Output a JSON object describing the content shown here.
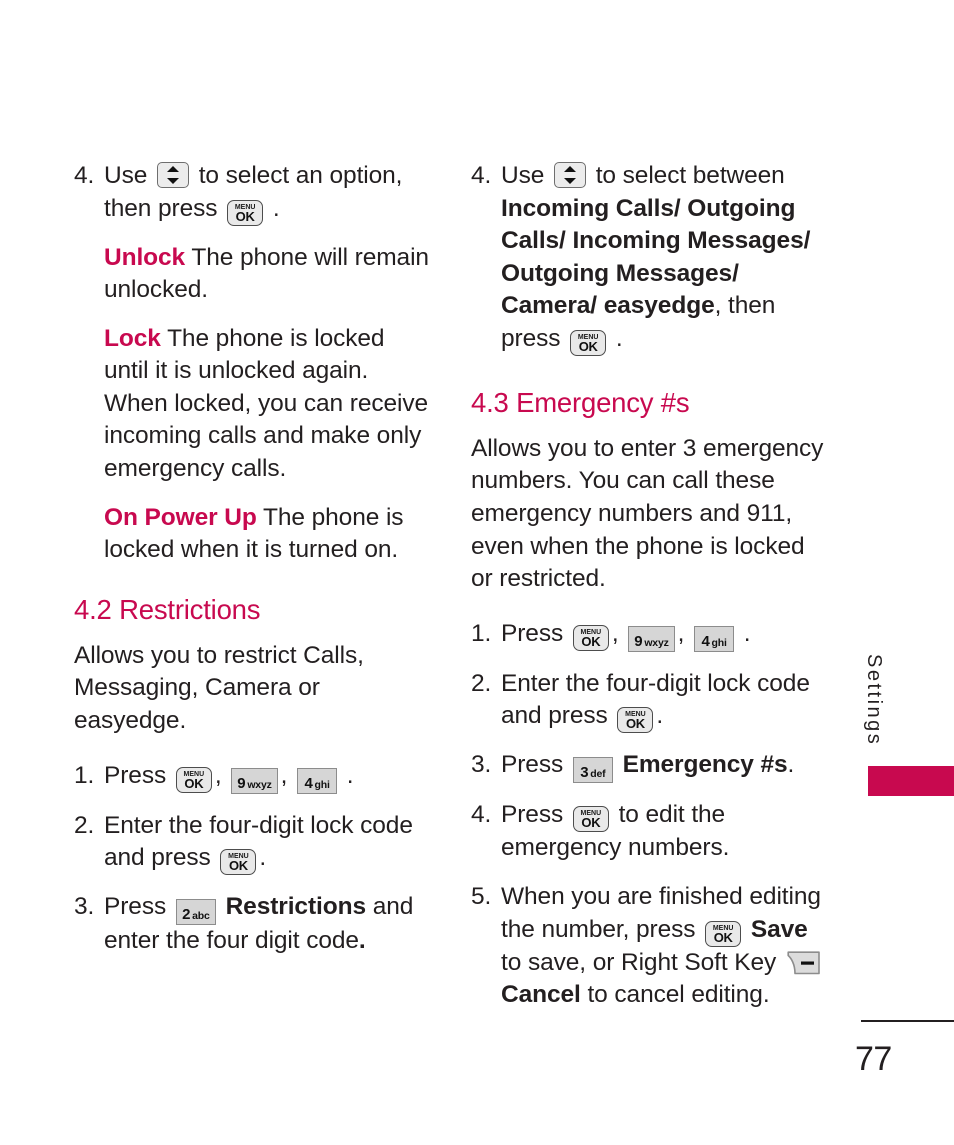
{
  "page": {
    "number": "77",
    "side_tab_label": "Settings",
    "accent_color": "#c8094f",
    "text_color": "#231f20"
  },
  "icons": {
    "nav_key": "updown-nav-key-icon",
    "menu_ok_key": "menu-ok-key-icon",
    "right_soft_key": "right-soft-key-icon",
    "menu_label_top": "MENU",
    "menu_label_bottom": "OK"
  },
  "keys": {
    "k9": {
      "digit": "9",
      "letters": "wxyz"
    },
    "k4": {
      "digit": "4",
      "letters": "ghi"
    },
    "k2": {
      "digit": "2",
      "letters": "abc"
    },
    "k3": {
      "digit": "3",
      "letters": "def"
    }
  },
  "left_column": {
    "step4": {
      "num": "4.",
      "text_a": "Use",
      "text_b": "to select an option,",
      "text_c": "then press",
      "text_d": "."
    },
    "definitions": [
      {
        "term": "Unlock",
        "body": "The phone will remain unlocked."
      },
      {
        "term": "Lock",
        "body": "The phone is locked until it is unlocked again. When locked, you can receive incoming calls and make only emergency calls."
      },
      {
        "term": "On Power Up",
        "body": "The phone is locked when it is turned on."
      }
    ],
    "section": {
      "heading": "4.2 Restrictions",
      "intro": "Allows you to restrict Calls, Messaging, Camera or easyedge.",
      "steps": [
        {
          "num": "1.",
          "pre": "Press",
          "sep1": ",",
          "sep2": ",",
          "post": "."
        },
        {
          "num": "2.",
          "text_a": "Enter the four-digit lock code and press",
          "text_b": "."
        },
        {
          "num": "3.",
          "text_a": "Press",
          "bold": "Restrictions",
          "text_b": "and enter the four digit code",
          "text_c": "."
        }
      ]
    }
  },
  "right_column": {
    "step4": {
      "num": "4.",
      "text_a": "Use",
      "text_b": "to select between",
      "options_bold": "Incoming Calls/ Outgoing Calls/ Incoming Messages/ Outgoing Messages/ Camera/ easyedge",
      "text_c": ", then press",
      "text_d": "."
    },
    "section": {
      "heading": "4.3 Emergency #s",
      "intro": "Allows you to enter 3 emergency numbers. You can call these emergency numbers and 911, even when the phone is locked or restricted.",
      "steps": [
        {
          "num": "1.",
          "pre": "Press",
          "sep1": ",",
          "sep2": ",",
          "post": "."
        },
        {
          "num": "2.",
          "text_a": "Enter the four-digit lock code and press",
          "text_b": "."
        },
        {
          "num": "3.",
          "text_a": "Press",
          "bold": "Emergency #s",
          "text_b": "."
        },
        {
          "num": "4.",
          "text_a": "Press",
          "text_b": "to edit the emergency numbers."
        },
        {
          "num": "5.",
          "text_a": "When you are finished editing the number, press",
          "bold_a": "Save",
          "text_b": "to save, or Right Soft Key",
          "bold_b": "Cancel",
          "text_c": "to cancel editing."
        }
      ]
    }
  }
}
